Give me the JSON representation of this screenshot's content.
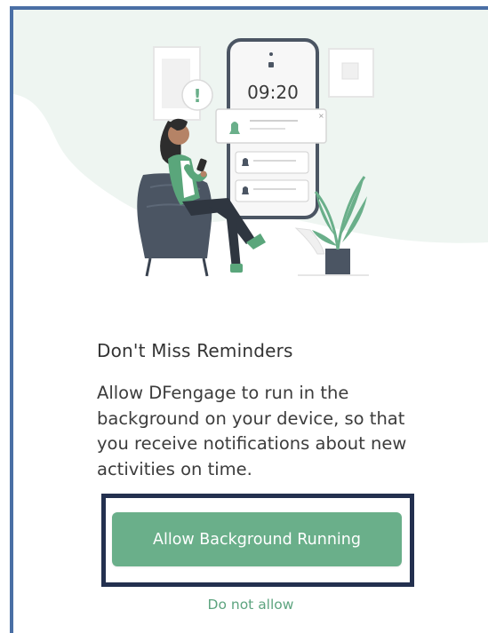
{
  "screen": {
    "title": "Don't Miss Reminders",
    "description": "Allow DFengage to run in the background on your device, so that you receive notifications about new activities on time.",
    "primary_button": "Allow Background Running",
    "secondary_link": "Do not allow"
  },
  "illustration": {
    "phone_time": "09:20",
    "alert_symbol": "!"
  },
  "colors": {
    "accent_green": "#6aaf8a",
    "link_green": "#5da47f",
    "frame_border": "#4a6fa5",
    "highlight_border": "#23304f"
  }
}
